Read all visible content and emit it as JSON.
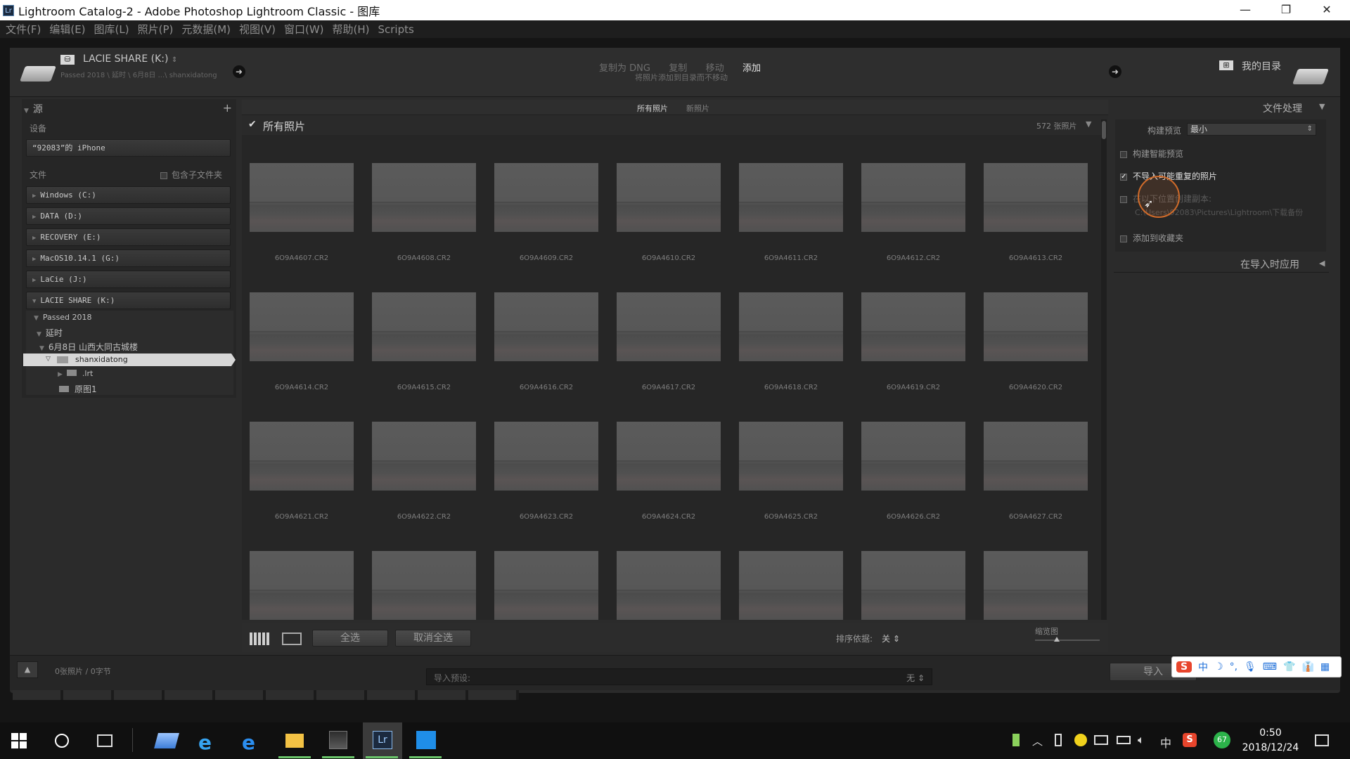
{
  "window": {
    "title": "Lightroom Catalog-2 - Adobe Photoshop Lightroom Classic - 图库",
    "app_badge": "Lr",
    "controls": [
      "—",
      "❐",
      "✕"
    ]
  },
  "menu": [
    "文件(F)",
    "编辑(E)",
    "图库(L)",
    "照片(P)",
    "元数据(M)",
    "视图(V)",
    "窗口(W)",
    "帮助(H)",
    "Scripts"
  ],
  "header": {
    "source_name": "LACIE SHARE (K:)",
    "source_path": "Passed 2018 \\ 延时 \\ 6月8日 ...\\ shanxidatong",
    "modes": [
      "复制为 DNG",
      "复制",
      "移动",
      "添加"
    ],
    "active_mode": "添加",
    "mode_desc": "将照片添加到目录而不移动",
    "destination": "我的目录"
  },
  "source_panel": {
    "title": "源",
    "devices_label": "设备",
    "device": "“92083”的 iPhone",
    "files_label": "文件",
    "include_sub": "包含子文件夹",
    "drives": [
      "Windows (C:)",
      "DATA (D:)",
      "RECOVERY (E:)",
      "MacOS10.14.1 (G:)",
      "LaCie (J:)",
      "LACIE SHARE (K:)"
    ],
    "tree": [
      {
        "label": "Passed 2018",
        "level": 1
      },
      {
        "label": "延时",
        "level": 2
      },
      {
        "label": "6月8日 山西大同古城楼",
        "level": 3
      },
      {
        "label": "shanxidatong",
        "level": 4,
        "selected": true
      },
      {
        "label": ".lrt",
        "level": 5
      },
      {
        "label": "原图1",
        "level": 5
      }
    ]
  },
  "grid": {
    "tabs": [
      "所有照片",
      "新照片"
    ],
    "active_tab": "所有照片",
    "header_label": "所有照片",
    "count": "572 张照片",
    "files": [
      "6O9A4607.CR2",
      "6O9A4608.CR2",
      "6O9A4609.CR2",
      "6O9A4610.CR2",
      "6O9A4611.CR2",
      "6O9A4612.CR2",
      "6O9A4613.CR2",
      "6O9A4614.CR2",
      "6O9A4615.CR2",
      "6O9A4616.CR2",
      "6O9A4617.CR2",
      "6O9A4618.CR2",
      "6O9A4619.CR2",
      "6O9A4620.CR2",
      "6O9A4621.CR2",
      "6O9A4622.CR2",
      "6O9A4623.CR2",
      "6O9A4624.CR2",
      "6O9A4625.CR2",
      "6O9A4626.CR2",
      "6O9A4627.CR2",
      "",
      "",
      "",
      "",
      "",
      "",
      ""
    ]
  },
  "toolbar": {
    "select_all": "全选",
    "deselect_all": "取消全选",
    "sort_label": "排序依据:",
    "sort_value": "关",
    "thumb_label": "缩览图"
  },
  "right_panel": {
    "title": "文件处理",
    "build_preview_label": "构建预览",
    "build_preview_value": "最小",
    "smart_preview": "构建智能预览",
    "no_duplicates": "不导入可能重复的照片",
    "second_copy": "在以下位置创建副本:",
    "second_copy_path": "C:\\Users\\92083\\Pictures\\Lightroom\\下载备份",
    "add_collection": "添加到收藏夹",
    "apply_during": "在导入时应用"
  },
  "footer": {
    "status": "0张照片 / 0字节",
    "preset_label": "导入预设:",
    "preset_value": "无",
    "import_btn": "导入"
  },
  "ime": [
    "S",
    "中",
    "☽",
    "°,",
    "🎙",
    "⌨",
    "👕",
    "👔",
    "▦"
  ],
  "taskbar": {
    "time": "0:50",
    "date": "2018/12/24",
    "ime": "中",
    "badge": "67"
  },
  "colors": {
    "background": "#2b2b2b",
    "selected_folder": "#d7d7d7",
    "taskbar": "#101010"
  }
}
